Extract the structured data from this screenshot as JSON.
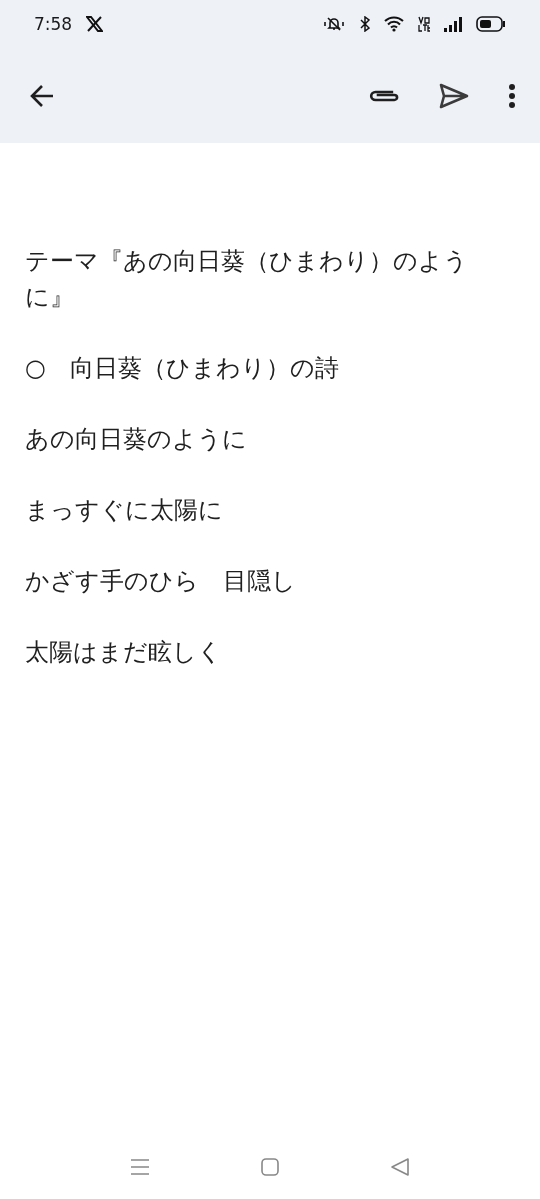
{
  "status_bar": {
    "time": "7:58"
  },
  "body": {
    "paragraphs": [
      "テーマ『あの向日葵（ひまわり）のように』",
      "○　向日葵（ひまわり）の詩",
      "あの向日葵のように",
      "まっすぐに太陽に",
      "かざす手のひら　目隠し",
      "太陽はまだ眩しく"
    ]
  }
}
